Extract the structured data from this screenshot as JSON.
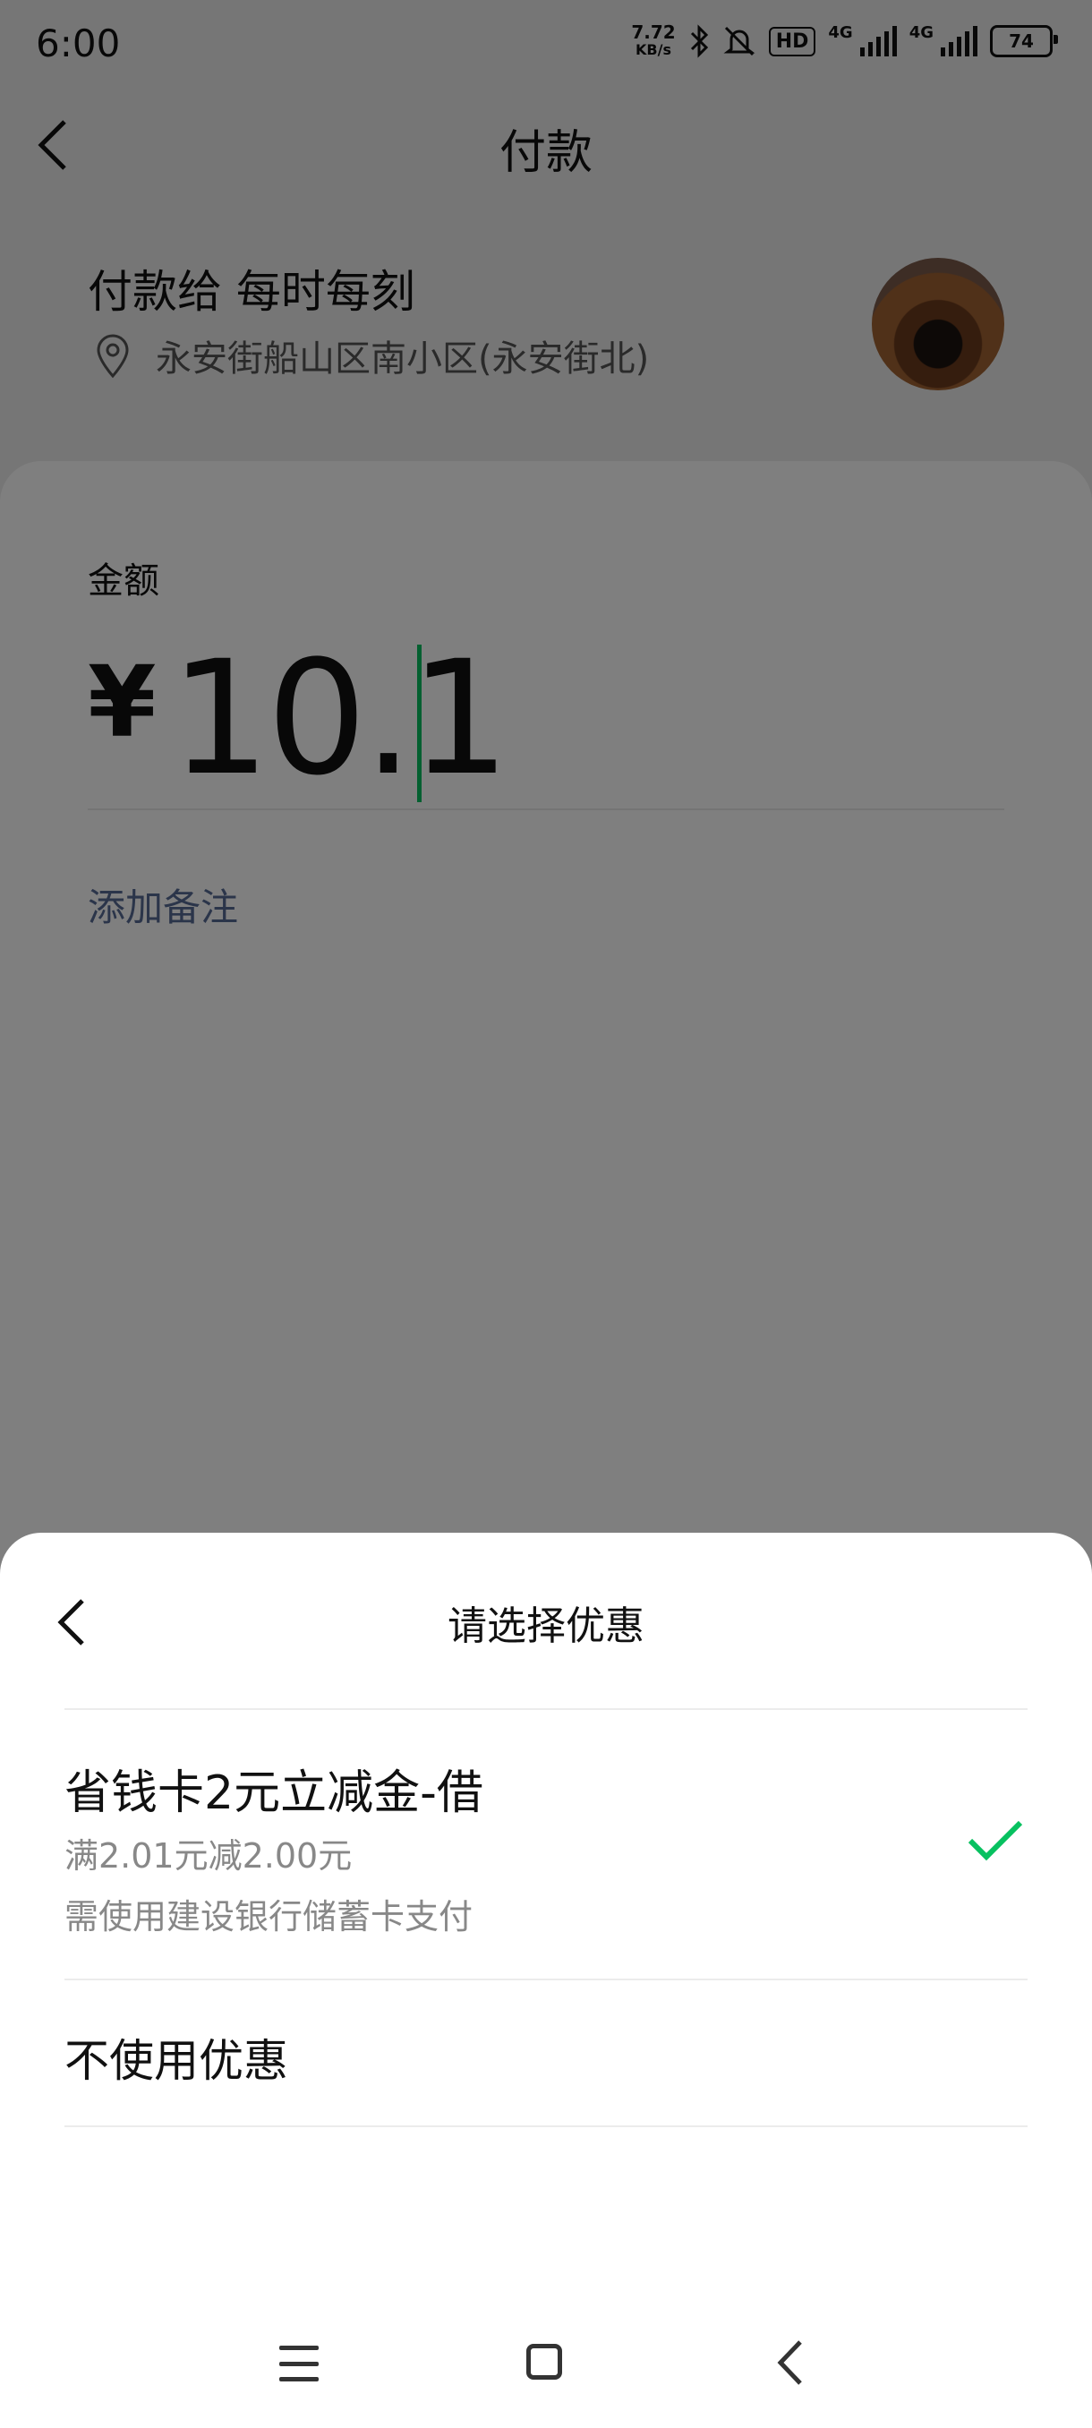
{
  "status_bar": {
    "time": "6:00",
    "speed_value": "7.72",
    "speed_unit": "KB/s",
    "hd_label": "HD",
    "network_1": "4G",
    "network_2": "4G",
    "battery": "74",
    "icons": [
      "bluetooth-icon",
      "mute-icon",
      "signal-icon",
      "battery-icon"
    ]
  },
  "header": {
    "title": "付款",
    "back_icon": "chevron-left-icon"
  },
  "payee": {
    "label": "付款给 每时每刻",
    "address": "永安街船山区南小区(永安街北)",
    "location_icon": "location-pin-icon"
  },
  "amount": {
    "label": "金额",
    "currency": "¥",
    "value": "10.1",
    "add_note": "添加备注"
  },
  "discount_sheet": {
    "title": "请选择优惠",
    "options": [
      {
        "title": "省钱卡2元立减金-借",
        "condition": "满2.01元减2.00元",
        "note": "需使用建设银行储蓄卡支付",
        "selected": true
      },
      {
        "title": "不使用优惠",
        "selected": false
      }
    ]
  },
  "colors": {
    "accent_green": "#07c160",
    "link_blue": "#576b95"
  }
}
